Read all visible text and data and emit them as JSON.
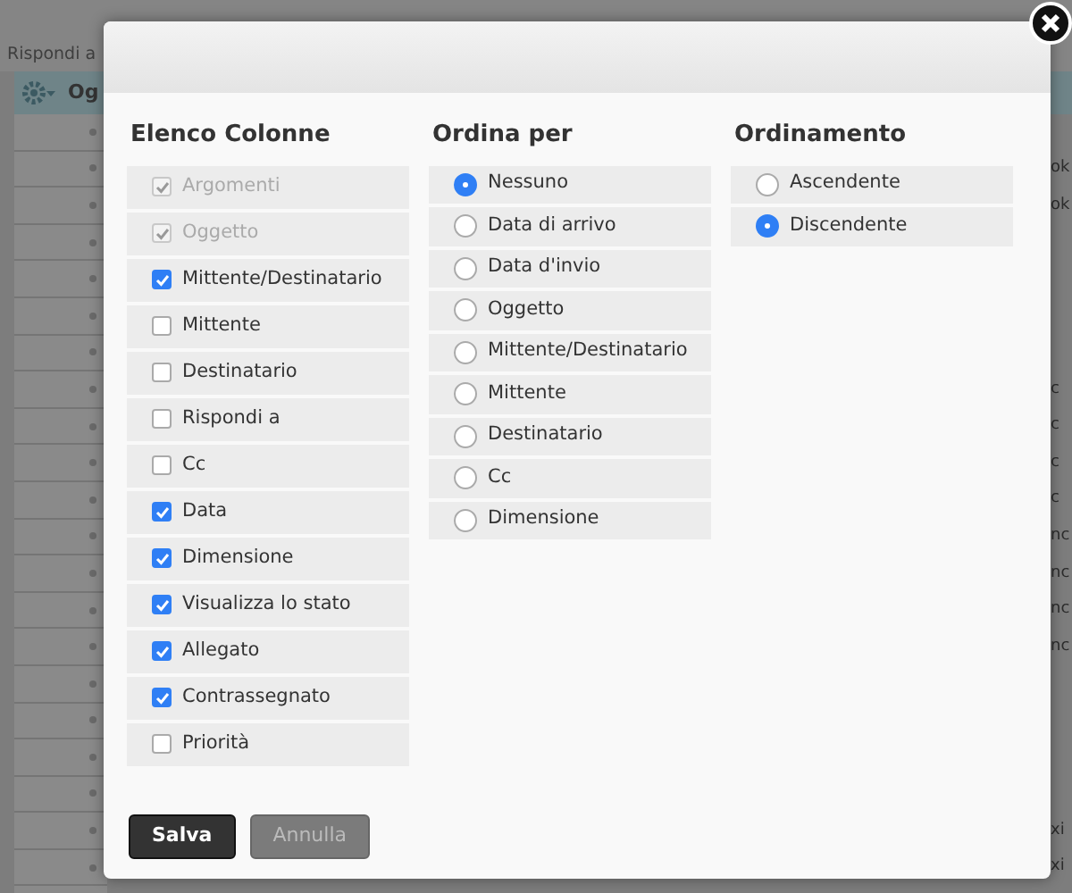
{
  "background": {
    "toolbar_label": "Rispondi a",
    "column_header": "Og",
    "edge_cells": [
      "ok",
      "ok",
      "c",
      "c",
      "c",
      "c",
      "nc",
      "nc",
      "nc",
      "nc",
      "xi",
      "xi"
    ]
  },
  "dialog": {
    "columns_list": {
      "title": "Elenco Colonne",
      "items": [
        {
          "label": "Argomenti",
          "checked": true,
          "disabled": true
        },
        {
          "label": "Oggetto",
          "checked": true,
          "disabled": true
        },
        {
          "label": "Mittente/Destinatario",
          "checked": true,
          "disabled": false
        },
        {
          "label": "Mittente",
          "checked": false,
          "disabled": false
        },
        {
          "label": "Destinatario",
          "checked": false,
          "disabled": false
        },
        {
          "label": "Rispondi a",
          "checked": false,
          "disabled": false
        },
        {
          "label": "Cc",
          "checked": false,
          "disabled": false
        },
        {
          "label": "Data",
          "checked": true,
          "disabled": false
        },
        {
          "label": "Dimensione",
          "checked": true,
          "disabled": false
        },
        {
          "label": "Visualizza lo stato",
          "checked": true,
          "disabled": false
        },
        {
          "label": "Allegato",
          "checked": true,
          "disabled": false
        },
        {
          "label": "Contrassegnato",
          "checked": true,
          "disabled": false
        },
        {
          "label": "Priorità",
          "checked": false,
          "disabled": false
        }
      ]
    },
    "sort_by": {
      "title": "Ordina per",
      "options": [
        {
          "label": "Nessuno",
          "selected": true
        },
        {
          "label": "Data di arrivo",
          "selected": false
        },
        {
          "label": "Data d'invio",
          "selected": false
        },
        {
          "label": "Oggetto",
          "selected": false
        },
        {
          "label": "Mittente/Destinatario",
          "selected": false
        },
        {
          "label": "Mittente",
          "selected": false
        },
        {
          "label": "Destinatario",
          "selected": false
        },
        {
          "label": "Cc",
          "selected": false
        },
        {
          "label": "Dimensione",
          "selected": false
        }
      ]
    },
    "order": {
      "title": "Ordinamento",
      "options": [
        {
          "label": "Ascendente",
          "selected": false
        },
        {
          "label": "Discendente",
          "selected": true
        }
      ]
    },
    "buttons": [
      {
        "label": "Salva",
        "kind": "primary"
      },
      {
        "label": "Annulla",
        "kind": "secondary"
      }
    ]
  }
}
